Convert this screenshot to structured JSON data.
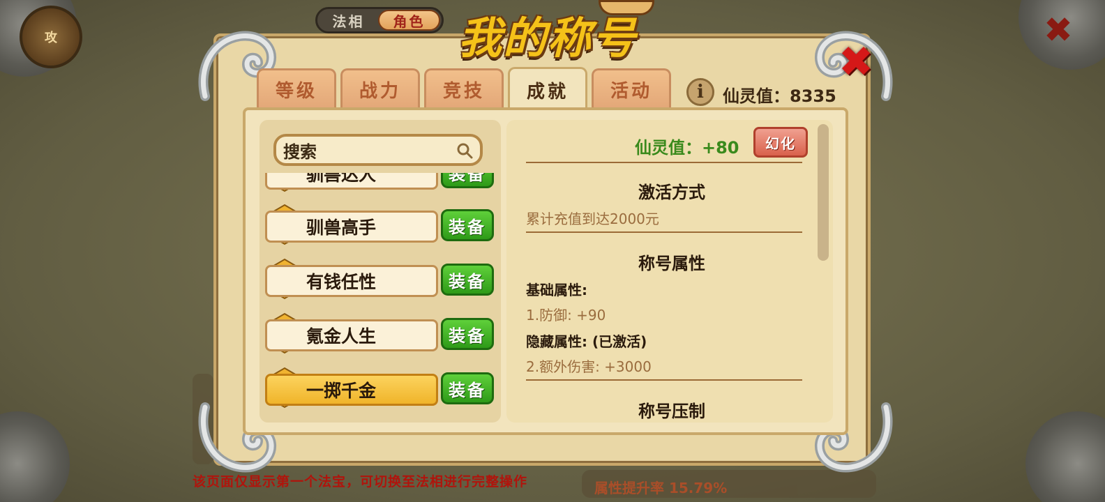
{
  "top_toggle": {
    "option_1": "法相",
    "option_2": "角色",
    "active": "角色"
  },
  "background": {
    "book_label": "攻"
  },
  "panel": {
    "title": "我的称号",
    "close_label": "✖"
  },
  "tabs": [
    {
      "label": "等级"
    },
    {
      "label": "战力"
    },
    {
      "label": "竞技"
    },
    {
      "label": "成就",
      "active": true
    },
    {
      "label": "活动"
    }
  ],
  "header": {
    "info_icon": "i",
    "spirit_total_label": "仙灵值：8335"
  },
  "search": {
    "placeholder": "搜索",
    "icon": "search-icon"
  },
  "title_list": {
    "items": [
      {
        "name": "驯兽达人",
        "equip_label": "装备",
        "badge_color": "#7a4bb4"
      },
      {
        "name": "驯兽高手",
        "equip_label": "装备",
        "badge_color": "#7a4bb4"
      },
      {
        "name": "有钱任性",
        "equip_label": "装备",
        "badge_color": "#3aa6b8"
      },
      {
        "name": "氪金人生",
        "equip_label": "装备",
        "badge_color": "#3aa6b8"
      },
      {
        "name": "一掷千金",
        "equip_label": "装备",
        "badge_color": "#3aa6b8",
        "selected": true
      }
    ]
  },
  "detail": {
    "spirit_bonus": "仙灵值：+80",
    "transform_label": "幻化",
    "activation_title": "激活方式",
    "activation_text": "累计充值到达2000元",
    "attr_title": "称号属性",
    "base_attr_label": "基础属性:",
    "base_attr_value": "1.防御: +90",
    "hidden_attr_label": "隐藏属性: (已激活)",
    "hidden_attr_value": "2.额外伤害: +3000",
    "suppress_title": "称号压制"
  },
  "footer": {
    "note": "该页面仅显示第一个法宝，可切换至法相进行完整操作",
    "strip_text": "属性提升率 15.79%"
  },
  "colors": {
    "accent_green": "#3a8a1c",
    "equip_green": "#2e9a18",
    "warning_red": "#b0140c"
  }
}
